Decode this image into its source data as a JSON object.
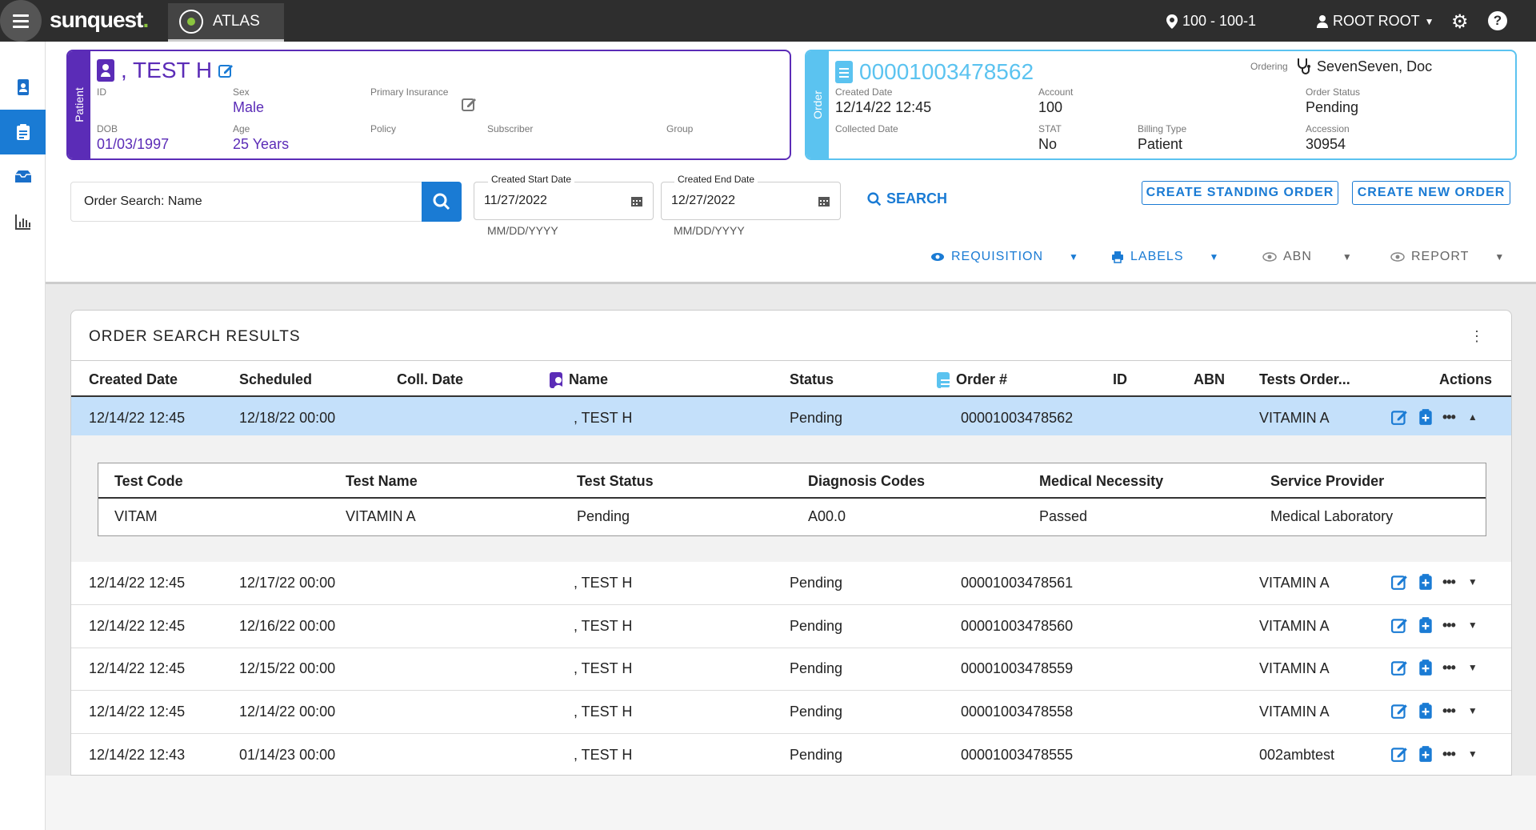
{
  "topbar": {
    "logo": "sunquest",
    "logo_dot": ".",
    "app_tab": "ATLAS",
    "location": "100 - 100-1",
    "user": "ROOT ROOT"
  },
  "sidebar": {
    "items": [
      {
        "name": "patient",
        "icon": "patient-badge-icon"
      },
      {
        "name": "orders",
        "icon": "clipboard-icon",
        "active": true
      },
      {
        "name": "inbox",
        "icon": "tray-icon"
      },
      {
        "name": "reports",
        "icon": "bar-chart-icon"
      }
    ]
  },
  "patient": {
    "side_label": "Patient",
    "name": ", TEST H",
    "id_label": "ID",
    "sex_label": "Sex",
    "sex": "Male",
    "primary_insurance_label": "Primary Insurance",
    "dob_label": "DOB",
    "dob": "01/03/1997",
    "age_label": "Age",
    "age": "25 Years",
    "policy_label": "Policy",
    "subscriber_label": "Subscriber",
    "group_label": "Group"
  },
  "order": {
    "side_label": "Order",
    "number": "00001003478562",
    "ordering_label": "Ordering",
    "ordering_doc": "SevenSeven, Doc",
    "created_date_label": "Created Date",
    "created_date": "12/14/22 12:45",
    "account_label": "Account",
    "account": "100",
    "order_status_label": "Order Status",
    "order_status": "Pending",
    "collected_date_label": "Collected Date",
    "stat_label": "STAT",
    "stat": "No",
    "billing_type_label": "Billing Type",
    "billing_type": "Patient",
    "accession_label": "Accession",
    "accession": "30954"
  },
  "search": {
    "placeholder": "Order Search: Name",
    "start_label": "Created Start Date",
    "start_value": "11/27/2022",
    "start_hint": "MM/DD/YYYY",
    "end_label": "Created End Date",
    "end_value": "12/27/2022",
    "end_hint": "MM/DD/YYYY",
    "search_label": "SEARCH",
    "create_standing": "CREATE STANDING ORDER",
    "create_new": "CREATE NEW ORDER"
  },
  "actions": {
    "requisition": "REQUISITION",
    "labels": "LABELS",
    "abn": "ABN",
    "report": "REPORT"
  },
  "results": {
    "title": "ORDER SEARCH RESULTS",
    "columns": [
      "Created Date",
      "Scheduled",
      "Coll. Date",
      "Name",
      "Status",
      "Order #",
      "ID",
      "ABN",
      "Tests Order...",
      "Actions"
    ],
    "rows": [
      {
        "created": "12/14/22 12:45",
        "scheduled": "12/18/22 00:00",
        "name": ", TEST H",
        "status": "Pending",
        "order": "00001003478562",
        "tests": "VITAMIN A"
      },
      {
        "created": "12/14/22 12:45",
        "scheduled": "12/17/22 00:00",
        "name": ", TEST H",
        "status": "Pending",
        "order": "00001003478561",
        "tests": "VITAMIN A"
      },
      {
        "created": "12/14/22 12:45",
        "scheduled": "12/16/22 00:00",
        "name": ", TEST H",
        "status": "Pending",
        "order": "00001003478560",
        "tests": "VITAMIN A"
      },
      {
        "created": "12/14/22 12:45",
        "scheduled": "12/15/22 00:00",
        "name": ", TEST H",
        "status": "Pending",
        "order": "00001003478559",
        "tests": "VITAMIN A"
      },
      {
        "created": "12/14/22 12:45",
        "scheduled": "12/14/22 00:00",
        "name": ", TEST H",
        "status": "Pending",
        "order": "00001003478558",
        "tests": "VITAMIN A"
      },
      {
        "created": "12/14/22 12:43",
        "scheduled": "01/14/23 00:00",
        "name": ", TEST H",
        "status": "Pending",
        "order": "00001003478555",
        "tests": "002ambtest"
      }
    ],
    "detail": {
      "columns": [
        "Test Code",
        "Test Name",
        "Test Status",
        "Diagnosis Codes",
        "Medical Necessity",
        "Service Provider"
      ],
      "row": [
        "VITAM",
        "VITAMIN A",
        "Pending",
        "A00.0",
        "Passed",
        "Medical Laboratory"
      ]
    }
  },
  "colors": {
    "patient_accent": "#5b2cb7",
    "order_accent": "#5bc3f0",
    "primary_blue": "#1a7bd4",
    "selected_row": "#c4e0fa"
  }
}
